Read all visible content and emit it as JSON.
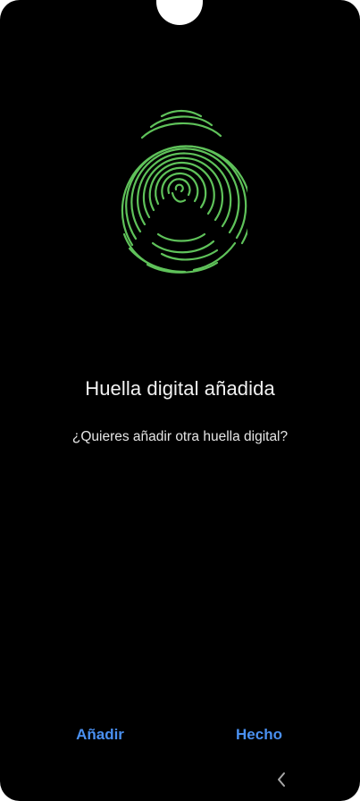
{
  "screen": {
    "title": "Huella digital añadida",
    "subtitle": "¿Quieres añadir otra huella digital?"
  },
  "actions": {
    "add_label": "Añadir",
    "done_label": "Hecho"
  },
  "icons": {
    "fingerprint": "fingerprint-icon",
    "back": "back-chevron-icon"
  },
  "colors": {
    "background": "#000000",
    "accent": "#4a90f0",
    "fingerprint": "#5fc25a",
    "text": "#f2f2f2"
  }
}
